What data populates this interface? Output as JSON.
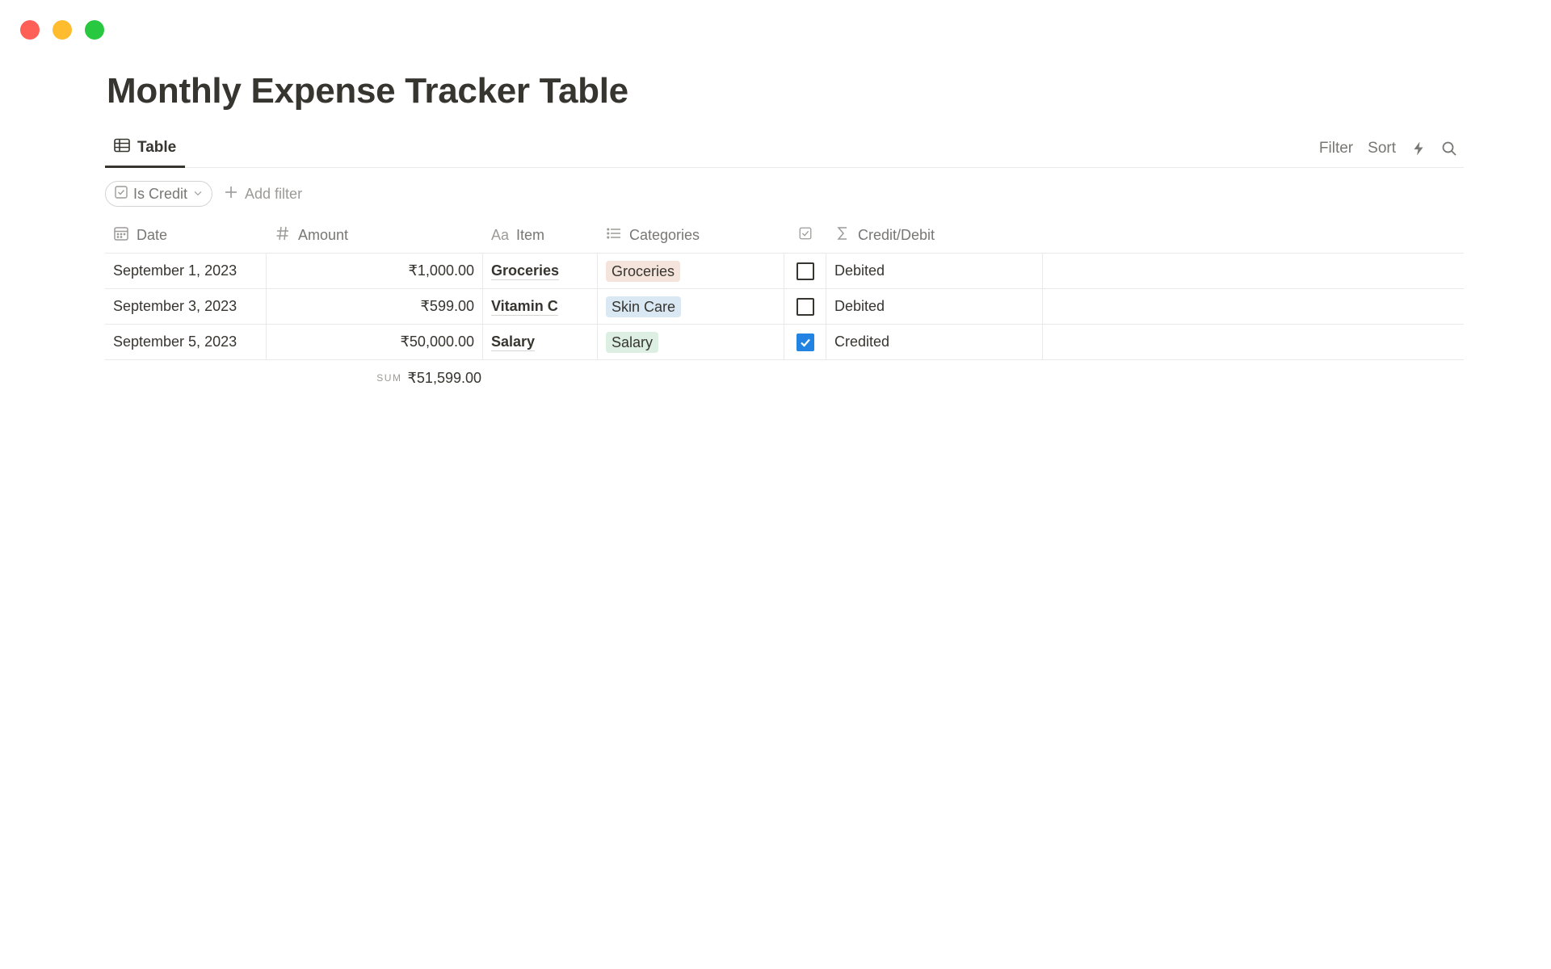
{
  "window": {
    "controls": [
      "close",
      "minimize",
      "maximize"
    ],
    "colors": {
      "close": "#fe5f57",
      "minimize": "#febc2e",
      "maximize": "#28c840"
    }
  },
  "page": {
    "title": "Monthly Expense Tracker Table"
  },
  "view": {
    "tab_label": "Table",
    "tab_icon": "table-icon",
    "actions": {
      "filter": "Filter",
      "sort": "Sort"
    }
  },
  "filters": {
    "active": {
      "label": "Is Credit",
      "icon": "checkbox-icon"
    },
    "add_label": "Add filter"
  },
  "table": {
    "columns": {
      "date": {
        "label": "Date",
        "icon": "calendar-icon"
      },
      "amount": {
        "label": "Amount",
        "icon": "hash-icon"
      },
      "item": {
        "label": "Item",
        "icon": "text-icon"
      },
      "categories": {
        "label": "Categories",
        "icon": "list-icon"
      },
      "check": {
        "label": "",
        "icon": "checkbox-icon"
      },
      "credit_debit": {
        "label": "Credit/Debit",
        "icon": "sigma-icon"
      }
    },
    "rows": [
      {
        "date": "September 1, 2023",
        "amount": "₹1,000.00",
        "item": "Groceries",
        "category": "Groceries",
        "category_color": "#f4e4dc",
        "checked": false,
        "credit_debit": "Debited"
      },
      {
        "date": "September 3, 2023",
        "amount": "₹599.00",
        "item": "Vitamin C",
        "category": "Skin Care",
        "category_color": "#d9e8f3",
        "checked": false,
        "credit_debit": "Debited"
      },
      {
        "date": "September 5, 2023",
        "amount": "₹50,000.00",
        "item": "Salary",
        "category": "Salary",
        "category_color": "#dcefe2",
        "checked": true,
        "credit_debit": "Credited"
      }
    ],
    "sum": {
      "label": "SUM",
      "value": "₹51,599.00"
    }
  }
}
